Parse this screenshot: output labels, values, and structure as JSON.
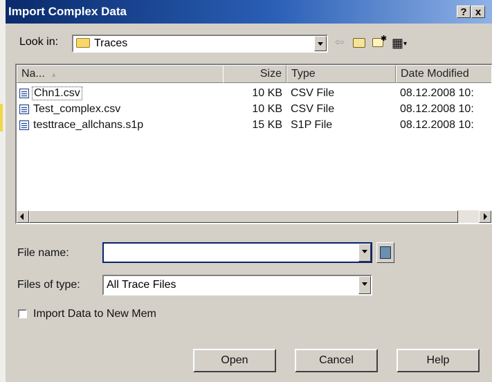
{
  "window": {
    "title": "Import Complex Data",
    "help_label": "?",
    "close_label": "x"
  },
  "lookin": {
    "label": "Look in:",
    "value": "Traces",
    "back_glyph": "⇦",
    "up_glyph": "↑",
    "newfolder_glyph": "✱",
    "views_glyph": "▦"
  },
  "list": {
    "headers": [
      "Na...",
      "Size",
      "Type",
      "Date Modified"
    ],
    "rows": [
      {
        "name": "Chn1.csv",
        "size": "10 KB",
        "type": "CSV File",
        "date": "08.12.2008 10:"
      },
      {
        "name": "Test_complex.csv",
        "size": "10 KB",
        "type": "CSV File",
        "date": "08.12.2008 10:"
      },
      {
        "name": "testtrace_allchans.s1p",
        "size": "15 KB",
        "type": "S1P File",
        "date": "08.12.2008 10:"
      }
    ]
  },
  "filename": {
    "label": "File name:",
    "value": ""
  },
  "filetype": {
    "label": "Files of type:",
    "value": "All Trace Files"
  },
  "import_checkbox": {
    "label": "Import Data to New Mem",
    "checked": false
  },
  "buttons": {
    "open": "Open",
    "cancel": "Cancel",
    "help": "Help"
  }
}
